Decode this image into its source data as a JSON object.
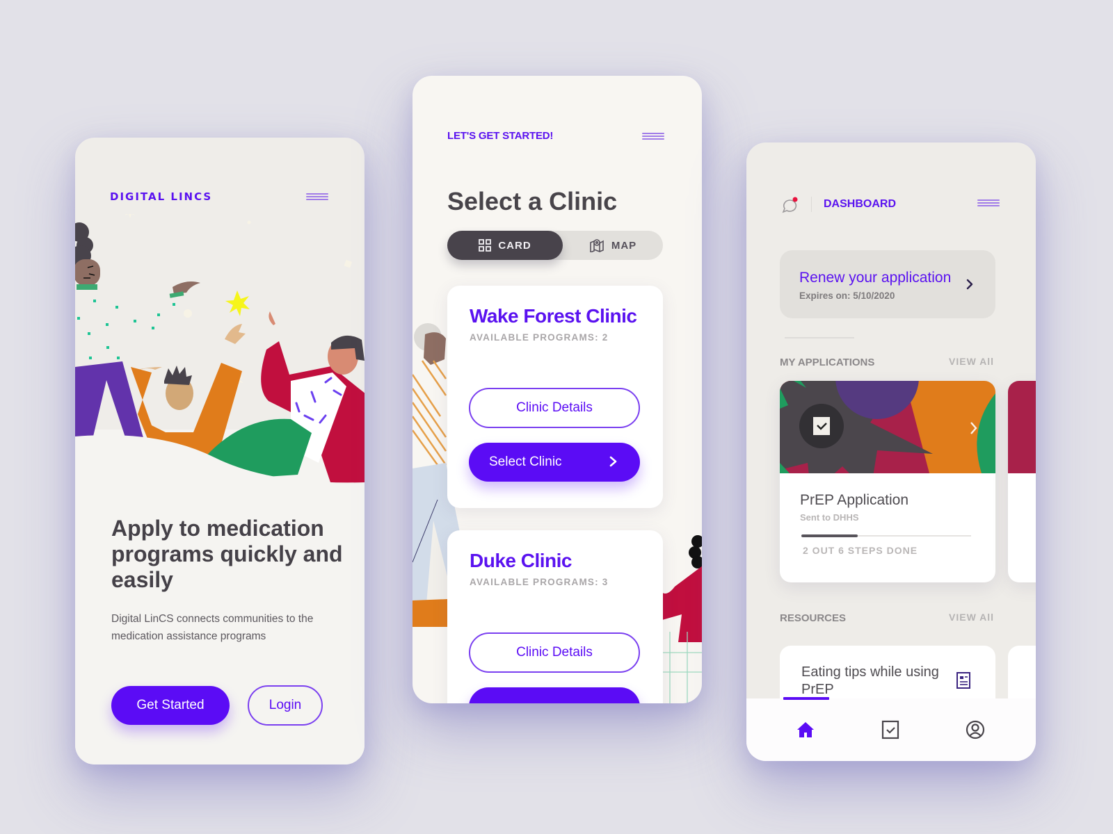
{
  "colors": {
    "accent": "#5b0cf5",
    "background": "#e2e1e8",
    "text_dark": "#48444a",
    "muted": "#a9a6a8"
  },
  "screen1": {
    "brand": "DIGITAL LINCS",
    "menu_icon": "hamburger-icon",
    "illustration": "people-celebrating-illustration",
    "headline": "Apply to medication programs quickly and easily",
    "subtext": "Digital LinCS connects communities to the medication assistance programs",
    "get_started_label": "Get Started",
    "login_label": "Login"
  },
  "screen2": {
    "kicker": "LET'S GET STARTED!",
    "menu_icon": "hamburger-icon",
    "title": "Select a Clinic",
    "view_toggle": {
      "options": [
        {
          "label": "CARD",
          "icon": "grid-icon",
          "selected": true
        },
        {
          "label": "MAP",
          "icon": "map-pin-icon",
          "selected": false
        }
      ]
    },
    "clinics": [
      {
        "name": "Wake Forest Clinic",
        "programs": "AVAILABLE PROGRAMS: 2",
        "details_label": "Clinic Details",
        "select_label": "Select Clinic"
      },
      {
        "name": "Duke Clinic",
        "programs": "AVAILABLE PROGRAMS: 3",
        "details_label": "Clinic Details",
        "select_label": ""
      }
    ]
  },
  "screen3": {
    "chat_icon": "chat-notification-icon",
    "title": "DASHBOARD",
    "menu_icon": "hamburger-icon",
    "renew": {
      "title": "Renew your application",
      "subtitle": "Expires on: 5/10/2020"
    },
    "applications": {
      "label": "MY APPLICATIONS",
      "view_all": "VIEW All",
      "items": [
        {
          "name": "PrEP Application",
          "status": "Sent to DHHS",
          "steps_done": 2,
          "steps_total": 6,
          "progress_text": "2 OUT 6 STEPS DONE"
        }
      ]
    },
    "resources": {
      "label": "RESOURCES",
      "view_all": "VIEW All",
      "items": [
        {
          "title": "Eating tips while using PrEP",
          "icon": "document-icon"
        }
      ]
    },
    "tabbar": {
      "tabs": [
        {
          "name": "home",
          "icon": "home-icon",
          "active": true
        },
        {
          "name": "tasks",
          "icon": "checkbox-icon",
          "active": false
        },
        {
          "name": "profile",
          "icon": "user-circle-icon",
          "active": false
        }
      ]
    }
  }
}
